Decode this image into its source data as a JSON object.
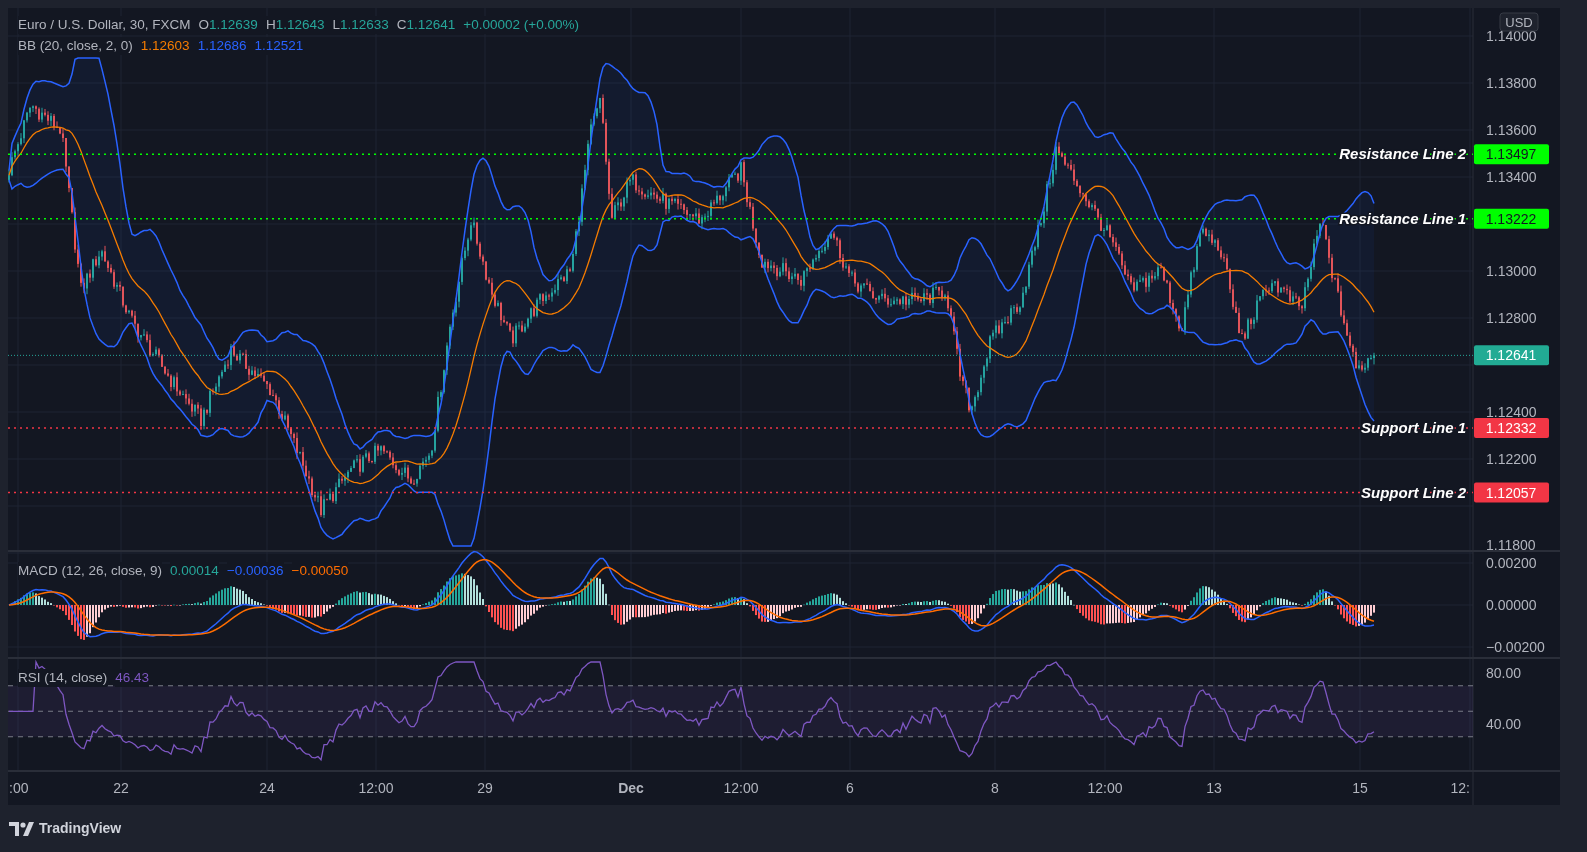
{
  "legend": {
    "symbol": "Euro / U.S. Dollar, 30, FXCM",
    "ohlc": [
      {
        "label": "O",
        "value": "1.12639"
      },
      {
        "label": "H",
        "value": "1.12643"
      },
      {
        "label": "L",
        "value": "1.12633"
      },
      {
        "label": "C",
        "value": "1.12641"
      }
    ],
    "change": "+0.00002 (+0.00%)"
  },
  "bb": {
    "title": "BB (20, close, 2, 0)",
    "values": [
      {
        "text": "1.12603",
        "color": "#f57c00"
      },
      {
        "text": "1.12686",
        "color": "#2962ff"
      },
      {
        "text": "1.12521",
        "color": "#2962ff"
      }
    ]
  },
  "currency": "USD",
  "price_ticks": [
    "1.14000",
    "1.13800",
    "1.13600",
    "1.13400",
    "1.13000",
    "1.12800",
    "1.12400",
    "1.12200",
    "1.11800"
  ],
  "levels": [
    {
      "label": "Resistance Line 2",
      "value": "1.13497",
      "kind": "resistance"
    },
    {
      "label": "Resistance Line 1",
      "value": "1.13222",
      "kind": "resistance"
    },
    {
      "label": "Support Line 1",
      "value": "1.12332",
      "kind": "support"
    },
    {
      "label": "Support Line 2",
      "value": "1.12057",
      "kind": "support"
    }
  ],
  "last_price": "1.12641",
  "macd": {
    "title": "MACD (12, 26, close, 9)",
    "values": [
      {
        "text": "0.00014",
        "color": "#26a69a"
      },
      {
        "text": "−0.00036",
        "color": "#2962ff"
      },
      {
        "text": "−0.00050",
        "color": "#ff6d00"
      }
    ],
    "ticks": [
      "0.00200",
      "0.00000",
      "−0.00200"
    ]
  },
  "rsi": {
    "title": "RSI (14, close)",
    "value": "46.43",
    "ticks": [
      "80.00",
      "40.00"
    ]
  },
  "time_axis": [
    {
      "label": ":00",
      "bold": false
    },
    {
      "label": "22",
      "bold": false
    },
    {
      "label": "24",
      "bold": false
    },
    {
      "label": "12:00",
      "bold": false
    },
    {
      "label": "29",
      "bold": false
    },
    {
      "label": "Dec",
      "bold": true
    },
    {
      "label": "12:00",
      "bold": false
    },
    {
      "label": "6",
      "bold": false
    },
    {
      "label": "8",
      "bold": false
    },
    {
      "label": "12:00",
      "bold": false
    },
    {
      "label": "13",
      "bold": false
    },
    {
      "label": "15",
      "bold": false
    },
    {
      "label": "12:",
      "bold": false
    }
  ],
  "footer": {
    "brand": "TradingView"
  }
}
